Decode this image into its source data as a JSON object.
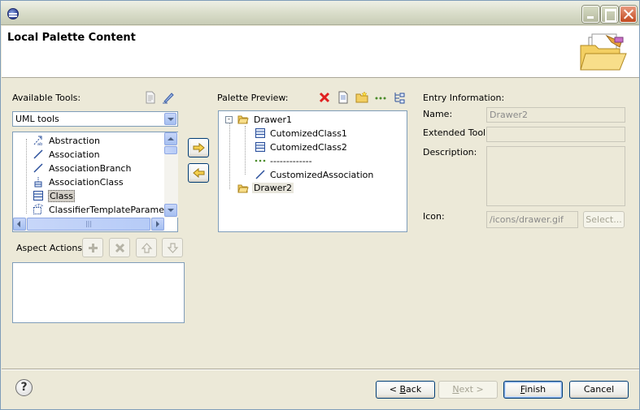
{
  "dialog": {
    "title": "Local Palette Content"
  },
  "available_tools": {
    "label": "Available Tools:",
    "combo_value": "UML tools",
    "items": [
      {
        "label": "Abstraction",
        "icon": "abstraction-icon"
      },
      {
        "label": "Association",
        "icon": "association-icon"
      },
      {
        "label": "AssociationBranch",
        "icon": "association-branch-icon"
      },
      {
        "label": "AssociationClass",
        "icon": "association-class-icon"
      },
      {
        "label": "Class",
        "icon": "class-icon",
        "selected": true
      },
      {
        "label": "ClassifierTemplateParameter",
        "icon": "template-parameter-icon"
      }
    ],
    "scroll_grip": "|||"
  },
  "aspect_actions": {
    "label": "Aspect Actions:"
  },
  "palette_preview": {
    "label": "Palette Preview:",
    "tree": [
      {
        "label": "Drawer1",
        "icon": "drawer-folder-icon",
        "expanded": true,
        "children": [
          {
            "label": "CutomizedClass1",
            "icon": "class-icon"
          },
          {
            "label": "CutomizedClass2",
            "icon": "class-icon"
          },
          {
            "label": "-------------",
            "icon": "separator-icon"
          },
          {
            "label": "CustomizedAssociation",
            "icon": "association-icon"
          }
        ]
      },
      {
        "label": "Drawer2",
        "icon": "drawer-folder-icon",
        "selected": true
      }
    ]
  },
  "entry_information": {
    "label": "Entry Information:",
    "name_label": "Name:",
    "name_value": "Drawer2",
    "extended_tool_label": "Extended Tool:",
    "extended_tool_value": "",
    "description_label": "Description:",
    "description_value": "",
    "icon_label": "Icon:",
    "icon_value": "/icons/drawer.gif",
    "select_button": "Select..."
  },
  "footer": {
    "help": "?",
    "back": "< Back",
    "back_mnemonic": "B",
    "next": "Next >",
    "next_mnemonic": "N",
    "finish": "Finish",
    "finish_mnemonic": "F",
    "cancel": "Cancel"
  },
  "colors": {
    "title_bar": "#d8dcc8",
    "dialog_bg": "#ece9d8",
    "border_blue": "#7f9db9",
    "delete_red": "#e02020",
    "folder_yellow": "#f3cf62"
  }
}
